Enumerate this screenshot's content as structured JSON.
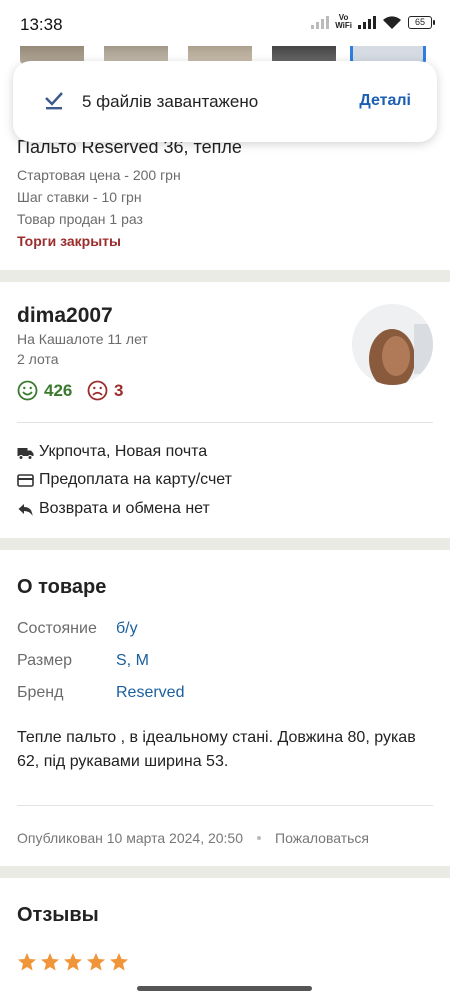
{
  "status_bar": {
    "time": "13:38",
    "vowifi_top": "Vo",
    "vowifi_bottom": "WiFi",
    "battery": "65"
  },
  "notification": {
    "message": "5 файлів завантажено",
    "action": "Деталі",
    "icon": "check-icon"
  },
  "lot": {
    "title": "Пальто Reserved 36, тепле",
    "start_price": "Стартовая цена - 200 грн",
    "bid_step": "Шаг ставки - 10 грн",
    "sold_count": "Товар продан 1 раз",
    "status": "Торги закрыты"
  },
  "seller": {
    "name": "dima2007",
    "member_since": "На Кашалоте 11 лет",
    "lots": "2 лота",
    "positive": "426",
    "negative": "3"
  },
  "features": [
    {
      "icon": "truck-icon",
      "label": "Укрпочта, Новая почта"
    },
    {
      "icon": "card-icon",
      "label": "Предоплата на карту/счет"
    },
    {
      "icon": "return-icon",
      "label": "Возврата и обмена нет"
    }
  ],
  "about": {
    "heading": "О товаре",
    "properties": [
      {
        "label": "Состояние",
        "value": "б/у"
      },
      {
        "label": "Размер",
        "value": "S, M"
      },
      {
        "label": "Бренд",
        "value": "Reserved"
      }
    ],
    "description": "Тепле пальто , в ідеальному стані. Довжина 80, рукав 62, під рукавами ширина 53.",
    "published": "Опубликован 10 марта 2024, 20:50",
    "report": "Пожаловаться"
  },
  "reviews": {
    "heading": "Отзывы",
    "stars": 5
  },
  "colors": {
    "link": "#1a5f9e",
    "accent": "#1a5fb4",
    "positive": "#3a7a2e",
    "negative": "#9b2d2d",
    "star": "#f0953a",
    "separator": "#ebebe6"
  }
}
